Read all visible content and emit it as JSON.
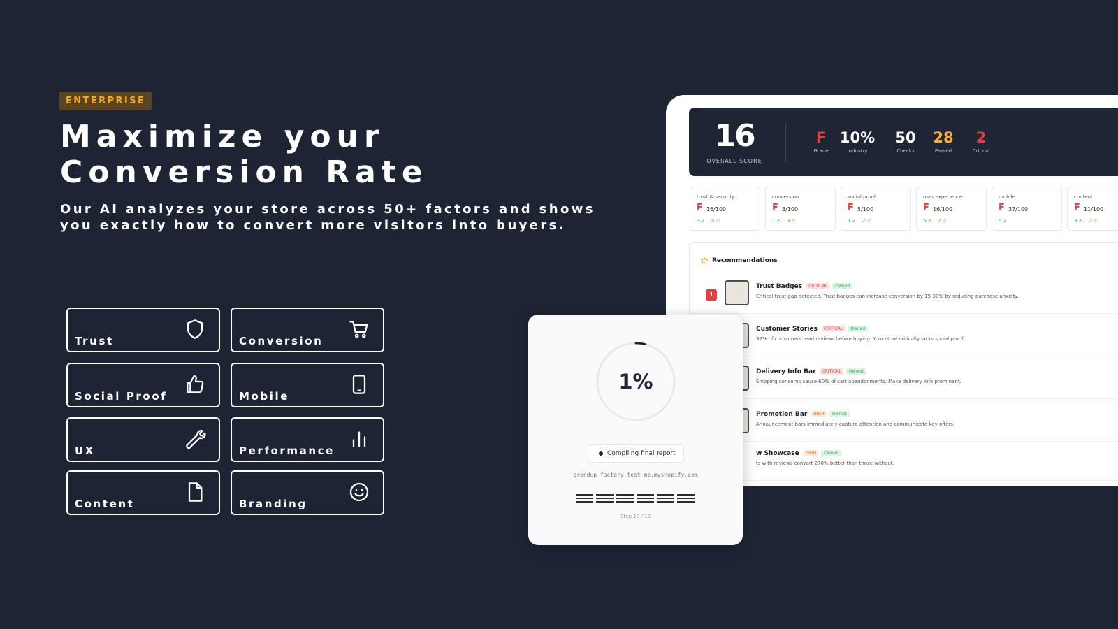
{
  "badge": "ENTERPRISE",
  "hero": {
    "title": "Maximize your Conversion Rate",
    "subtitle": "Our AI analyzes your store across 50+ factors and shows you exactly how to convert more visitors into buyers."
  },
  "factors": [
    {
      "label": "Trust",
      "icon": "shield-icon"
    },
    {
      "label": "Conversion",
      "icon": "cart-icon"
    },
    {
      "label": "Social Proof",
      "icon": "thumbs-up-icon"
    },
    {
      "label": "Mobile",
      "icon": "mobile-icon"
    },
    {
      "label": "UX",
      "icon": "wrench-icon"
    },
    {
      "label": "Performance",
      "icon": "bar-chart-icon"
    },
    {
      "label": "Content",
      "icon": "document-icon"
    },
    {
      "label": "Branding",
      "icon": "smiley-icon"
    }
  ],
  "dashboard": {
    "overall_score": "16",
    "overall_label": "OVERALL SCORE",
    "stats": [
      {
        "value": "F",
        "label": "Grade",
        "color": "#e53e3e"
      },
      {
        "value": "10%",
        "label": "Industry",
        "color": "#ffffff"
      },
      {
        "value": "50",
        "label": "Checks",
        "color": "#ffffff"
      },
      {
        "value": "28",
        "label": "Passed",
        "color": "#f6ad37"
      },
      {
        "value": "2",
        "label": "Critical",
        "color": "#e53e3e"
      }
    ],
    "categories": [
      {
        "name": "trust & security",
        "grade": "F",
        "score": "16/100",
        "checks": "3 ✓",
        "warns": "5 ⚠"
      },
      {
        "name": "conversion",
        "grade": "F",
        "score": "3/100",
        "checks": "1 ✓",
        "warns": "3 ⚠"
      },
      {
        "name": "social proof",
        "grade": "F",
        "score": "5/100",
        "checks": "1 ✓",
        "warns": "2 ⚠"
      },
      {
        "name": "user experience",
        "grade": "F",
        "score": "16/100",
        "checks": "5 ✓",
        "warns": "2 ⚠"
      },
      {
        "name": "mobile",
        "grade": "F",
        "score": "37/100",
        "checks": "5 ✓",
        "warns": ""
      },
      {
        "name": "content",
        "grade": "F",
        "score": "11/100",
        "checks": "3 ✓",
        "warns": "2 ⚠"
      }
    ],
    "recommendations_title": "Recommendations",
    "recommendations": [
      {
        "num": "1",
        "title": "Trust Badges",
        "priority": "CRITICAL",
        "owned": "Owned",
        "desc": "Critical trust gap detected. Trust badges can increase conversion by 15-30% by reducing purchase anxiety."
      },
      {
        "num": "",
        "title": "Customer Stories",
        "priority": "CRITICAL",
        "owned": "Owned",
        "desc": "92% of consumers read reviews before buying. Your store critically lacks social proof."
      },
      {
        "num": "",
        "title": "Delivery Info Bar",
        "priority": "CRITICAL",
        "owned": "Owned",
        "desc": "Shipping concerns cause 60% of cart abandonments. Make delivery info prominent."
      },
      {
        "num": "",
        "title": "Promotion Bar",
        "priority": "HIGH",
        "owned": "Owned",
        "desc": "Announcement bars immediately capture attention and communicate key offers."
      },
      {
        "num": "",
        "title": "w Showcase",
        "priority": "HIGH",
        "owned": "Owned",
        "desc": "ts with reviews convert 270% better than those without."
      }
    ]
  },
  "loader": {
    "percent": "1%",
    "progress": 0.01,
    "status": "Compiling final report",
    "url": "brendup-factory-test-me.myshopify.com",
    "step": "Step 18 / 18"
  },
  "colors": {
    "background": "#1d2535",
    "accent": "#f4a825",
    "critical": "#e53e3e",
    "warning": "#dd6b20",
    "success": "#38a169"
  }
}
